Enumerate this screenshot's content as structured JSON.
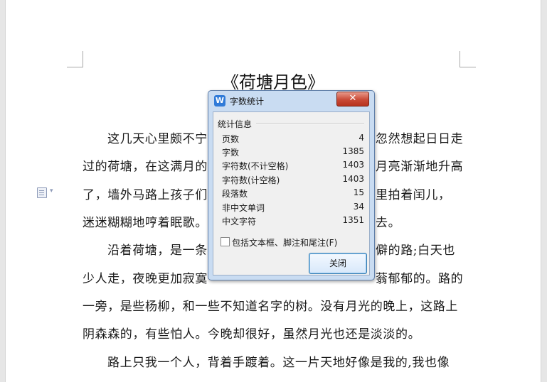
{
  "document": {
    "title": "《荷塘月色》",
    "lines": [
      "这几天心里颇不宁",
      "忽然想起日日走",
      "过的荷塘，在这满月的",
      "月亮渐渐地升高",
      "了，墙外马路上孩子们",
      "里拍着闰儿，",
      "迷迷糊糊地哼着眠歌。",
      "去。",
      "沿着荷塘，是一条",
      "僻的路;白天也",
      "少人走，夜晚更加寂寞",
      "蓊郁郁的。路的",
      "一旁，是些杨柳，和一些不知道名字的树。没有月光的晚上，这路上",
      "阴森森的，有些怕人。今晚却很好，虽然月光也还是淡淡的。",
      "路上只我一个人，背着手踱着。这一片天地好像是我的,我也像"
    ]
  },
  "dialog": {
    "title": "字数统计",
    "icon_letter": "W",
    "close_glyph": "✕",
    "group_label": "统计信息",
    "stats": [
      {
        "label": "页数",
        "value": "4"
      },
      {
        "label": "字数",
        "value": "1385"
      },
      {
        "label": "字符数(不计空格)",
        "value": "1403"
      },
      {
        "label": "字符数(计空格)",
        "value": "1403"
      },
      {
        "label": "段落数",
        "value": "15"
      },
      {
        "label": "非中文单词",
        "value": "34"
      },
      {
        "label": "中文字符",
        "value": "1351"
      }
    ],
    "checkbox_label": "包括文本框、脚注和尾注(F)",
    "checkbox_checked": false,
    "close_button_label": "关闭"
  },
  "colors": {
    "dialog_frame": "#c9dcf2",
    "close_button": "#c94a37",
    "app_icon": "#2f7ad8"
  }
}
